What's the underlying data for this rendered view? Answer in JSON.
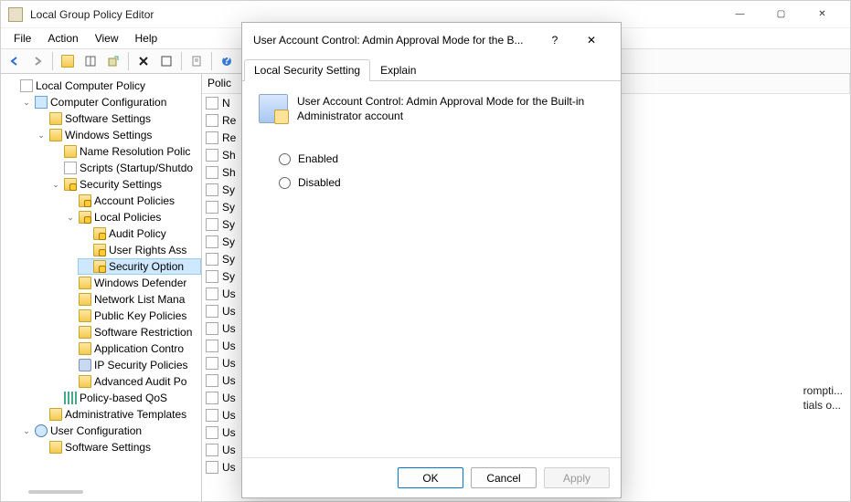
{
  "window": {
    "title": "Local Group Policy Editor",
    "controls": {
      "min": "—",
      "max": "▢",
      "close": "✕"
    }
  },
  "menubar": [
    "File",
    "Action",
    "View",
    "Help"
  ],
  "toolbar_icons": [
    "back",
    "forward",
    "up",
    "show-hide",
    "export",
    "delete",
    "refresh",
    "properties",
    "help",
    "filter"
  ],
  "tree": {
    "root": "Local Computer Policy",
    "items": [
      {
        "label": "Computer Configuration",
        "icon": "pc",
        "children": [
          {
            "label": "Software Settings",
            "icon": "folder"
          },
          {
            "label": "Windows Settings",
            "icon": "folder",
            "children": [
              {
                "label": "Name Resolution Polic",
                "icon": "folder"
              },
              {
                "label": "Scripts (Startup/Shutdo",
                "icon": "doc"
              },
              {
                "label": "Security Settings",
                "icon": "folder-lock",
                "children": [
                  {
                    "label": "Account Policies",
                    "icon": "folder-lock"
                  },
                  {
                    "label": "Local Policies",
                    "icon": "folder-lock",
                    "children": [
                      {
                        "label": "Audit Policy",
                        "icon": "folder-lock"
                      },
                      {
                        "label": "User Rights Ass",
                        "icon": "folder-lock"
                      },
                      {
                        "label": "Security Option",
                        "icon": "folder-lock",
                        "selected": true
                      }
                    ]
                  },
                  {
                    "label": "Windows Defender",
                    "icon": "folder"
                  },
                  {
                    "label": "Network List Mana",
                    "icon": "folder"
                  },
                  {
                    "label": "Public Key Policies",
                    "icon": "folder"
                  },
                  {
                    "label": "Software Restriction",
                    "icon": "folder"
                  },
                  {
                    "label": "Application Contro",
                    "icon": "folder"
                  },
                  {
                    "label": "IP Security Policies",
                    "icon": "shield"
                  },
                  {
                    "label": "Advanced Audit Po",
                    "icon": "folder"
                  }
                ]
              },
              {
                "label": "Policy-based QoS",
                "icon": "bars"
              }
            ]
          },
          {
            "label": "Administrative Templates",
            "icon": "folder"
          }
        ]
      },
      {
        "label": "User Configuration",
        "icon": "user",
        "children": [
          {
            "label": "Software Settings",
            "icon": "folder"
          }
        ]
      }
    ]
  },
  "list": {
    "header": "Polic",
    "rows": [
      "N",
      "Re",
      "Re",
      "Sh",
      "Sh",
      "Sy",
      "Sy",
      "Sy",
      "Sy",
      "Sy",
      "Sy",
      "Us",
      "Us",
      "Us",
      "Us",
      "Us",
      "Us",
      "Us",
      "Us",
      "Us",
      "Us",
      "Us"
    ]
  },
  "peek": [
    "rompti...",
    "tials o..."
  ],
  "dialog": {
    "title": "User Account Control: Admin Approval Mode for the B...",
    "help_glyph": "?",
    "close_glyph": "✕",
    "tabs": {
      "active": "Local Security Setting",
      "other": "Explain"
    },
    "heading": "User Account Control: Admin Approval Mode for the Built-in Administrator account",
    "options": {
      "enabled": "Enabled",
      "disabled": "Disabled",
      "selected": null
    },
    "buttons": {
      "ok": "OK",
      "cancel": "Cancel",
      "apply": "Apply"
    }
  }
}
